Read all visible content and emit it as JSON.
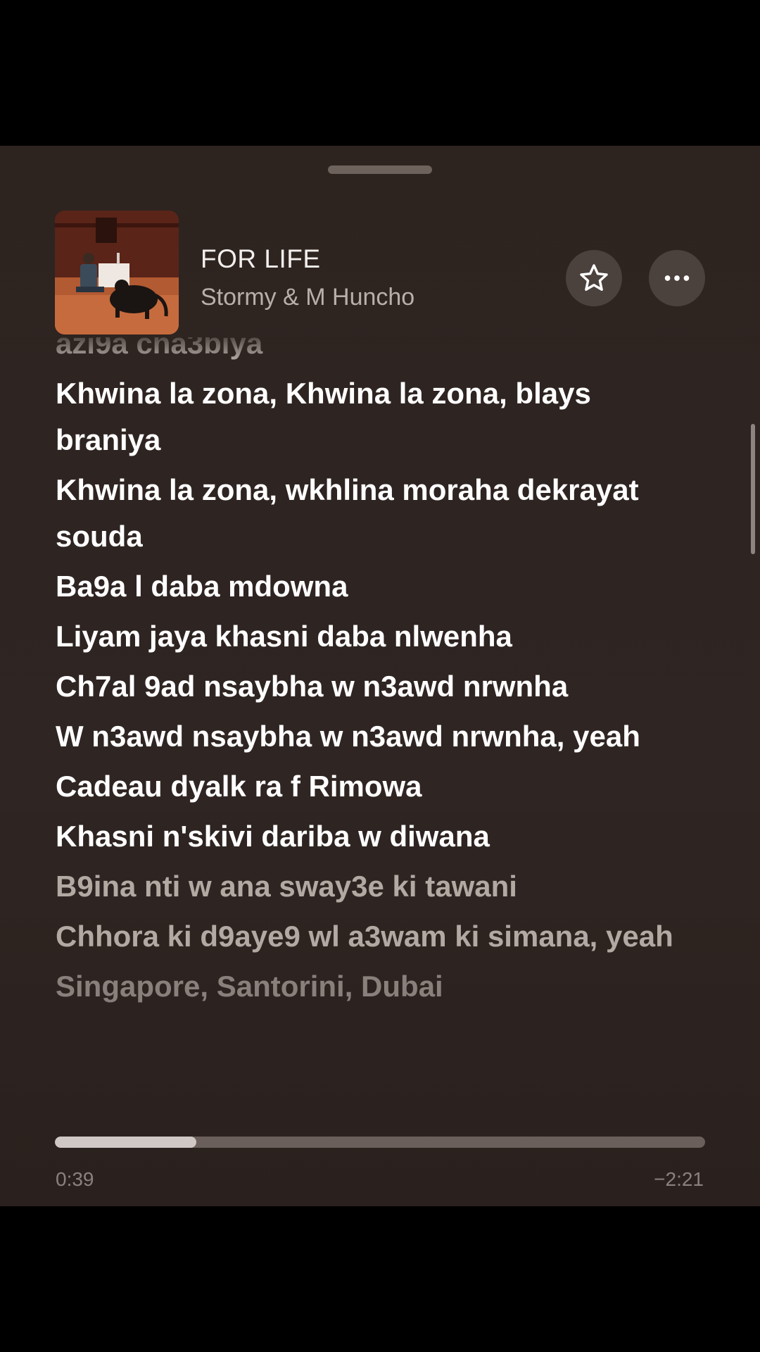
{
  "now_playing": {
    "title": "FOR LIFE",
    "artist": "Stormy & M Huncho",
    "artwork_icon": "album-artwork"
  },
  "actions": {
    "favorite_icon": "star-icon",
    "more_icon": "ellipsis-icon"
  },
  "lyrics": [
    {
      "text": "azi9a cha3biya",
      "state": "past"
    },
    {
      "text": "Khwina la zona, Khwina la zona, blays braniya",
      "state": "active"
    },
    {
      "text": "Khwina la zona, wkhlina moraha dekrayat souda",
      "state": "active"
    },
    {
      "text": "Ba9a l daba mdowna",
      "state": "active"
    },
    {
      "text": "Liyam jaya khasni daba nlwenha",
      "state": "active"
    },
    {
      "text": "Ch7al 9ad nsaybha w n3awd nrwnha",
      "state": "active"
    },
    {
      "text": "W n3awd nsaybha w n3awd nrwnha, yeah",
      "state": "active"
    },
    {
      "text": "Cadeau dyalk ra f Rimowa",
      "state": "active"
    },
    {
      "text": "Khasni n'skivi dariba w diwana",
      "state": "active"
    },
    {
      "text": "B9ina nti w ana sway3e ki tawani",
      "state": "upcoming"
    },
    {
      "text": "Chhora ki d9aye9 wl a3wam ki simana, yeah",
      "state": "upcoming"
    },
    {
      "text": "Singapore, Santorini, Dubai",
      "state": "upcoming-far"
    }
  ],
  "playback": {
    "elapsed": "0:39",
    "remaining": "−2:21",
    "progress": 0.218
  },
  "colors": {
    "background": "#2e2421",
    "lyric_active": "#ffffff",
    "lyric_upcoming": "#b3a9a3",
    "progress_fill": "#cfc8c4",
    "progress_track": "#6a5f5a"
  }
}
